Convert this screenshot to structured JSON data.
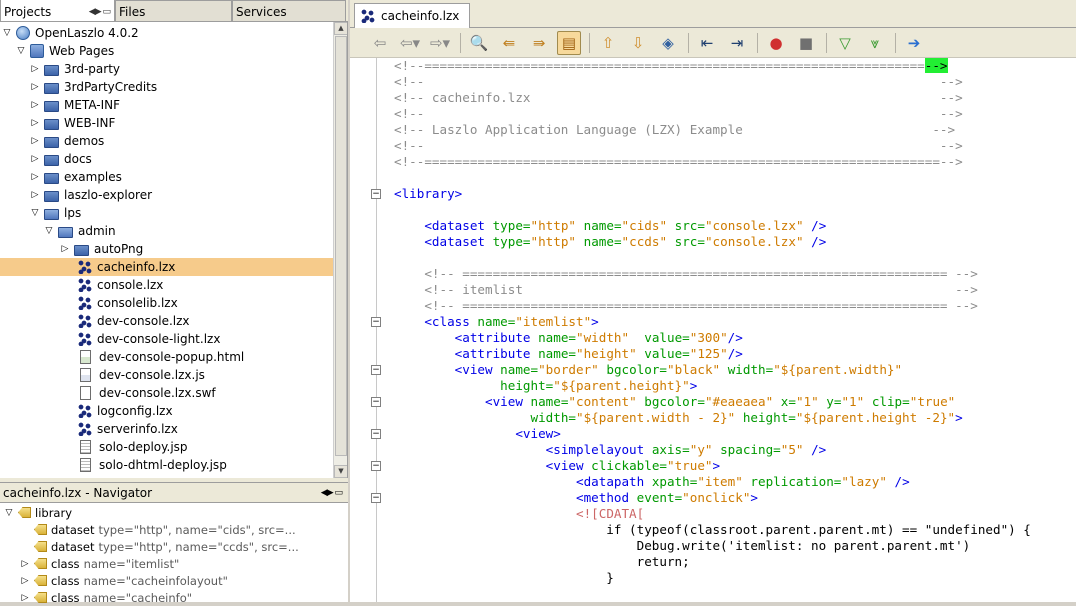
{
  "left_tabs": {
    "projects": "Projects",
    "files": "Files",
    "services": "Services"
  },
  "tree": [
    {
      "label": "OpenLaszlo 4.0.2",
      "indent": 0,
      "icon": "project-globe-icon",
      "exp": "open"
    },
    {
      "label": "Web Pages",
      "indent": 1,
      "icon": "web-pages-folder-icon",
      "exp": "open"
    },
    {
      "label": "3rd-party",
      "indent": 2,
      "icon": "folder-icon",
      "exp": "closed"
    },
    {
      "label": "3rdPartyCredits",
      "indent": 2,
      "icon": "folder-icon",
      "exp": "closed"
    },
    {
      "label": "META-INF",
      "indent": 2,
      "icon": "folder-icon",
      "exp": "closed"
    },
    {
      "label": "WEB-INF",
      "indent": 2,
      "icon": "folder-icon",
      "exp": "closed"
    },
    {
      "label": "demos",
      "indent": 2,
      "icon": "folder-icon",
      "exp": "closed"
    },
    {
      "label": "docs",
      "indent": 2,
      "icon": "folder-icon",
      "exp": "closed"
    },
    {
      "label": "examples",
      "indent": 2,
      "icon": "folder-icon",
      "exp": "closed"
    },
    {
      "label": "laszlo-explorer",
      "indent": 2,
      "icon": "folder-icon",
      "exp": "closed"
    },
    {
      "label": "lps",
      "indent": 2,
      "icon": "open-folder-icon",
      "exp": "open"
    },
    {
      "label": "admin",
      "indent": 3,
      "icon": "open-folder-icon",
      "exp": "open"
    },
    {
      "label": "autoPng",
      "indent": 4,
      "icon": "folder-icon",
      "exp": "closed"
    },
    {
      "label": "cacheinfo.lzx",
      "indent": 4,
      "icon": "lzx-file-icon",
      "exp": "none",
      "selected": true
    },
    {
      "label": "console.lzx",
      "indent": 4,
      "icon": "lzx-file-icon",
      "exp": "none"
    },
    {
      "label": "consolelib.lzx",
      "indent": 4,
      "icon": "lzx-file-icon",
      "exp": "none"
    },
    {
      "label": "dev-console.lzx",
      "indent": 4,
      "icon": "lzx-file-icon",
      "exp": "none"
    },
    {
      "label": "dev-console-light.lzx",
      "indent": 4,
      "icon": "lzx-file-icon",
      "exp": "none"
    },
    {
      "label": "dev-console-popup.html",
      "indent": 4,
      "icon": "html-file-icon",
      "exp": "none"
    },
    {
      "label": "dev-console.lzx.js",
      "indent": 4,
      "icon": "js-file-icon",
      "exp": "none"
    },
    {
      "label": "dev-console.lzx.swf",
      "indent": 4,
      "icon": "swf-file-icon",
      "exp": "none"
    },
    {
      "label": "logconfig.lzx",
      "indent": 4,
      "icon": "lzx-file-icon",
      "exp": "none"
    },
    {
      "label": "serverinfo.lzx",
      "indent": 4,
      "icon": "lzx-file-icon",
      "exp": "none"
    },
    {
      "label": "solo-deploy.jsp",
      "indent": 4,
      "icon": "jsp-file-icon",
      "exp": "none"
    },
    {
      "label": "solo-dhtml-deploy.jsp",
      "indent": 4,
      "icon": "jsp-file-icon",
      "exp": "none"
    }
  ],
  "navigator": {
    "title": "cacheinfo.lzx - Navigator",
    "items": [
      {
        "tag": "library",
        "attrs": "",
        "indent": 0,
        "exp": "open"
      },
      {
        "tag": "dataset",
        "attrs": "type=\"http\", name=\"cids\", src=...",
        "indent": 1,
        "exp": "none"
      },
      {
        "tag": "dataset",
        "attrs": "type=\"http\", name=\"ccds\", src=...",
        "indent": 1,
        "exp": "none"
      },
      {
        "tag": "class",
        "attrs": "name=\"itemlist\"",
        "indent": 1,
        "exp": "closed"
      },
      {
        "tag": "class",
        "attrs": "name=\"cacheinfolayout\"",
        "indent": 1,
        "exp": "closed"
      },
      {
        "tag": "class",
        "attrs": "name=\"cacheinfo\"",
        "indent": 1,
        "exp": "closed"
      }
    ]
  },
  "editor": {
    "tab_label": "cacheinfo.lzx",
    "lines": [
      [
        [
          "c",
          "<!--=================================================================="
        ],
        [
          "hl",
          "-->"
        ]
      ],
      [
        [
          "c",
          "<!--                                                                    -->"
        ]
      ],
      [
        [
          "c",
          "<!-- cacheinfo.lzx                                                      -->"
        ]
      ],
      [
        [
          "c",
          "<!--                                                                    -->"
        ]
      ],
      [
        [
          "c",
          "<!-- Laszlo Application Language (LZX) Example                         -->"
        ]
      ],
      [
        [
          "c",
          "<!--                                                                    -->"
        ]
      ],
      [
        [
          "c",
          "<!--====================================================================-->"
        ]
      ],
      [
        [
          "p",
          ""
        ]
      ],
      [
        [
          "t",
          "<library>"
        ]
      ],
      [
        [
          "p",
          ""
        ]
      ],
      [
        [
          "p",
          "    "
        ],
        [
          "t",
          "<dataset "
        ],
        [
          "a",
          "type="
        ],
        [
          "v",
          "\"http\""
        ],
        [
          "p",
          " "
        ],
        [
          "a",
          "name="
        ],
        [
          "v",
          "\"cids\""
        ],
        [
          "p",
          " "
        ],
        [
          "a",
          "src="
        ],
        [
          "v",
          "\"console.lzx\""
        ],
        [
          "p",
          " "
        ],
        [
          "t",
          "/>"
        ]
      ],
      [
        [
          "p",
          "    "
        ],
        [
          "t",
          "<dataset "
        ],
        [
          "a",
          "type="
        ],
        [
          "v",
          "\"http\""
        ],
        [
          "p",
          " "
        ],
        [
          "a",
          "name="
        ],
        [
          "v",
          "\"ccds\""
        ],
        [
          "p",
          " "
        ],
        [
          "a",
          "src="
        ],
        [
          "v",
          "\"console.lzx\""
        ],
        [
          "p",
          " "
        ],
        [
          "t",
          "/>"
        ]
      ],
      [
        [
          "p",
          ""
        ]
      ],
      [
        [
          "p",
          "    "
        ],
        [
          "c",
          "<!-- ================================================================ -->"
        ]
      ],
      [
        [
          "p",
          "    "
        ],
        [
          "c",
          "<!-- itemlist                                                         -->"
        ]
      ],
      [
        [
          "p",
          "    "
        ],
        [
          "c",
          "<!-- ================================================================ -->"
        ]
      ],
      [
        [
          "p",
          "    "
        ],
        [
          "t",
          "<class "
        ],
        [
          "a",
          "name="
        ],
        [
          "v",
          "\"itemlist\""
        ],
        [
          "t",
          ">"
        ]
      ],
      [
        [
          "p",
          "        "
        ],
        [
          "t",
          "<attribute "
        ],
        [
          "a",
          "name="
        ],
        [
          "v",
          "\"width\""
        ],
        [
          "p",
          "  "
        ],
        [
          "a",
          "value="
        ],
        [
          "v",
          "\"300\""
        ],
        [
          "t",
          "/>"
        ]
      ],
      [
        [
          "p",
          "        "
        ],
        [
          "t",
          "<attribute "
        ],
        [
          "a",
          "name="
        ],
        [
          "v",
          "\"height\""
        ],
        [
          "p",
          " "
        ],
        [
          "a",
          "value="
        ],
        [
          "v",
          "\"125\""
        ],
        [
          "t",
          "/>"
        ]
      ],
      [
        [
          "p",
          "        "
        ],
        [
          "t",
          "<view "
        ],
        [
          "a",
          "name="
        ],
        [
          "v",
          "\"border\""
        ],
        [
          "p",
          " "
        ],
        [
          "a",
          "bgcolor="
        ],
        [
          "v",
          "\"black\""
        ],
        [
          "p",
          " "
        ],
        [
          "a",
          "width="
        ],
        [
          "v",
          "\"${parent.width}\""
        ]
      ],
      [
        [
          "p",
          "              "
        ],
        [
          "a",
          "height="
        ],
        [
          "v",
          "\"${parent.height}\""
        ],
        [
          "t",
          ">"
        ]
      ],
      [
        [
          "p",
          "            "
        ],
        [
          "t",
          "<view "
        ],
        [
          "a",
          "name="
        ],
        [
          "v",
          "\"content\""
        ],
        [
          "p",
          " "
        ],
        [
          "a",
          "bgcolor="
        ],
        [
          "v",
          "\"#eaeaea\""
        ],
        [
          "p",
          " "
        ],
        [
          "a",
          "x="
        ],
        [
          "v",
          "\"1\""
        ],
        [
          "p",
          " "
        ],
        [
          "a",
          "y="
        ],
        [
          "v",
          "\"1\""
        ],
        [
          "p",
          " "
        ],
        [
          "a",
          "clip="
        ],
        [
          "v",
          "\"true\""
        ]
      ],
      [
        [
          "p",
          "                  "
        ],
        [
          "a",
          "width="
        ],
        [
          "v",
          "\"${parent.width - 2}\""
        ],
        [
          "p",
          " "
        ],
        [
          "a",
          "height="
        ],
        [
          "v",
          "\"${parent.height -2}\""
        ],
        [
          "t",
          ">"
        ]
      ],
      [
        [
          "p",
          "                "
        ],
        [
          "t",
          "<view>"
        ]
      ],
      [
        [
          "p",
          "                    "
        ],
        [
          "t",
          "<simplelayout "
        ],
        [
          "a",
          "axis="
        ],
        [
          "v",
          "\"y\""
        ],
        [
          "p",
          " "
        ],
        [
          "a",
          "spacing="
        ],
        [
          "v",
          "\"5\""
        ],
        [
          "p",
          " "
        ],
        [
          "t",
          "/>"
        ]
      ],
      [
        [
          "p",
          "                    "
        ],
        [
          "t",
          "<view "
        ],
        [
          "a",
          "clickable="
        ],
        [
          "v",
          "\"true\""
        ],
        [
          "t",
          ">"
        ]
      ],
      [
        [
          "p",
          "                        "
        ],
        [
          "t",
          "<datapath "
        ],
        [
          "a",
          "xpath="
        ],
        [
          "v",
          "\"item\""
        ],
        [
          "p",
          " "
        ],
        [
          "a",
          "replication="
        ],
        [
          "v",
          "\"lazy\""
        ],
        [
          "p",
          " "
        ],
        [
          "t",
          "/>"
        ]
      ],
      [
        [
          "p",
          "                        "
        ],
        [
          "t",
          "<method "
        ],
        [
          "a",
          "event="
        ],
        [
          "v",
          "\"onclick\""
        ],
        [
          "t",
          ">"
        ]
      ],
      [
        [
          "p",
          "                        "
        ],
        [
          "cd",
          "<![CDATA["
        ]
      ],
      [
        [
          "p",
          "                            if (typeof(classroot.parent.parent.mt) == \"undefined\") {"
        ]
      ],
      [
        [
          "p",
          "                                Debug.write('itemlist: no parent.parent.mt')"
        ]
      ],
      [
        [
          "p",
          "                                return;"
        ]
      ],
      [
        [
          "p",
          "                            }"
        ]
      ]
    ],
    "fold_lines": [
      8,
      16,
      19,
      21,
      23,
      25,
      27
    ]
  },
  "colors": {
    "selection": "#f6cb8b",
    "comment": "#8c8c8c",
    "tag": "#0000e6",
    "attribute": "#009900",
    "value": "#ce7b00"
  }
}
